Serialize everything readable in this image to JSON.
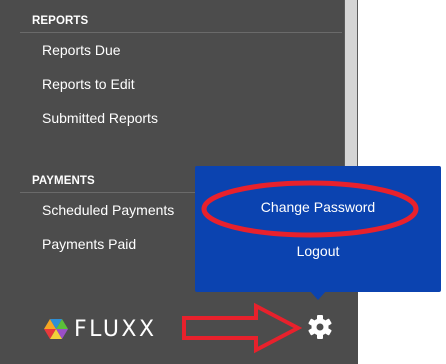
{
  "sidebar": {
    "sections": [
      {
        "header": "REPORTS",
        "items": [
          "Reports Due",
          "Reports to Edit",
          "Submitted Reports"
        ]
      },
      {
        "header": "PAYMENTS",
        "items": [
          "Scheduled Payments",
          "Payments Paid"
        ]
      }
    ]
  },
  "footer": {
    "logo_text": "FLUXX",
    "settings_icon": "gear-icon"
  },
  "popup": {
    "change_password_label": "Change Password",
    "logout_label": "Logout"
  },
  "colors": {
    "sidebar_bg": "#4c4c4c",
    "popup_bg": "#0b43b0",
    "annotation_red": "#e8212c"
  }
}
